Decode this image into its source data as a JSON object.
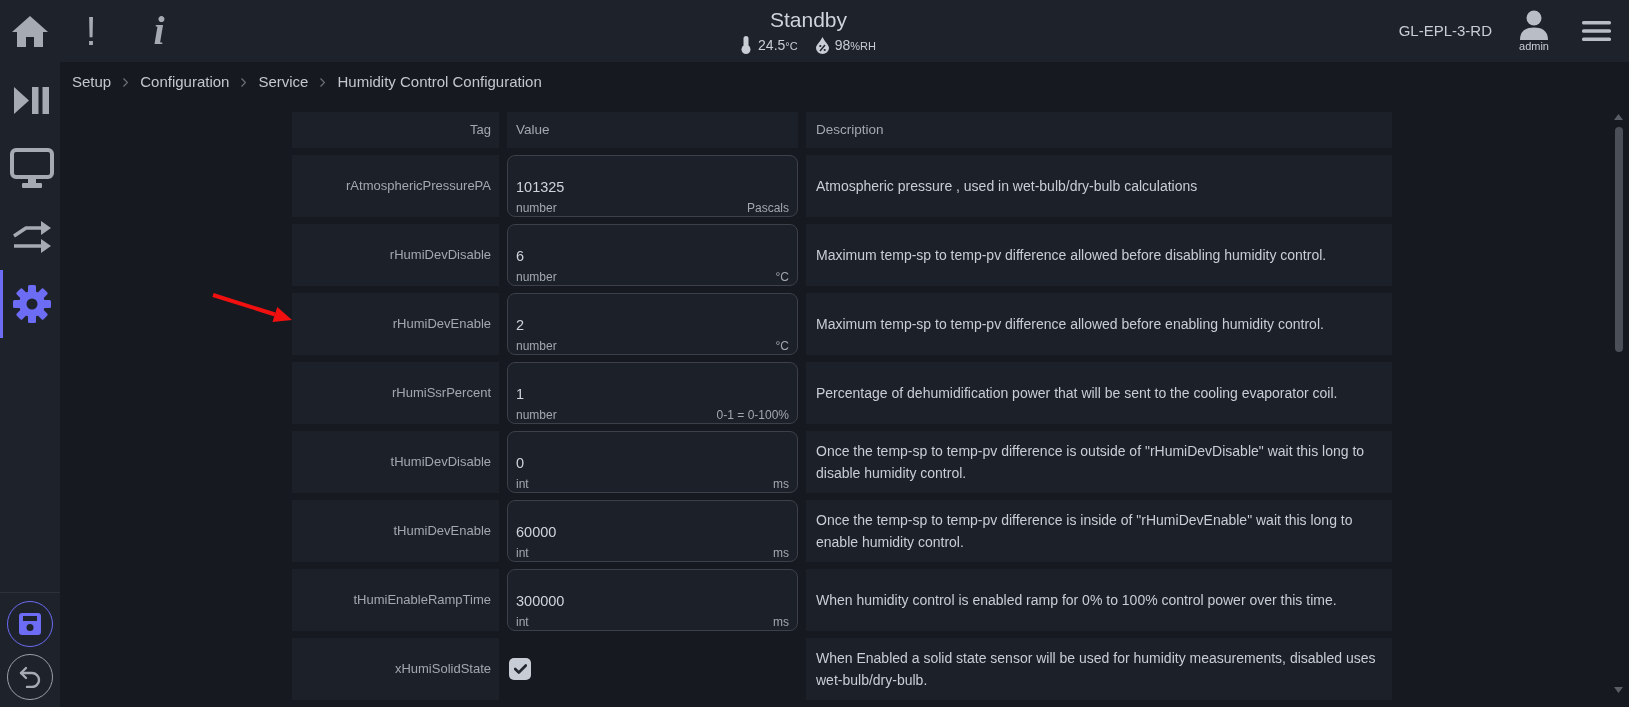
{
  "top_bar": {
    "buttons": [
      {
        "kind": "home"
      },
      {
        "kind": "alerts",
        "label": "!"
      },
      {
        "kind": "info",
        "label": "i"
      }
    ],
    "status": "Standby",
    "temperature": {
      "value": "24.5",
      "unit": "°C"
    },
    "humidity": {
      "value": "98",
      "unit": "%RH"
    },
    "device": "GL-EPL-3-RD",
    "user": "admin"
  },
  "sidebar": {
    "items": [
      {
        "kind": "play-pause",
        "selected": false
      },
      {
        "kind": "monitor",
        "selected": false
      },
      {
        "kind": "transfer",
        "selected": false
      },
      {
        "kind": "settings",
        "selected": true
      }
    ],
    "actions": [
      {
        "kind": "save",
        "highlighted": true
      },
      {
        "kind": "undo",
        "highlighted": false
      }
    ]
  },
  "breadcrumb": [
    "Setup",
    "Configuration",
    "Service",
    "Humidity Control Configuration"
  ],
  "table": {
    "columns": [
      "Tag",
      "Value",
      "Description"
    ],
    "rows": [
      {
        "tag": "rAtmosphericPressurePA",
        "kind": "field",
        "value": "101325",
        "data_type": "number",
        "unit": "Pascals",
        "description": "Atmospheric pressure , used in wet-bulb/dry-bulb calculations"
      },
      {
        "tag": "rHumiDevDisable",
        "kind": "field",
        "value": "6",
        "data_type": "number",
        "unit": "°C",
        "description": "Maximum temp-sp to temp-pv difference allowed before disabling humidity control."
      },
      {
        "tag": "rHumiDevEnable",
        "kind": "field",
        "value": "2",
        "data_type": "number",
        "unit": "°C",
        "description": "Maximum temp-sp to temp-pv difference allowed before enabling humidity control."
      },
      {
        "tag": "rHumiSsrPercent",
        "kind": "field",
        "value": "1",
        "data_type": "number",
        "unit": "0-1 = 0-100%",
        "description": "Percentage of dehumidification power that will be sent to the cooling evaporator coil."
      },
      {
        "tag": "tHumiDevDisable",
        "kind": "field",
        "value": "0",
        "data_type": "int",
        "unit": "ms",
        "description": "Once the temp-sp to temp-pv difference is outside of \"rHumiDevDisable\" wait this long to disable humidity control."
      },
      {
        "tag": "tHumiDevEnable",
        "kind": "field",
        "value": "60000",
        "data_type": "int",
        "unit": "ms",
        "description": "Once the temp-sp to temp-pv difference is inside of \"rHumiDevEnable\" wait this long to enable humidity control."
      },
      {
        "tag": "tHumiEnableRampTime",
        "kind": "field",
        "value": "300000",
        "data_type": "int",
        "unit": "ms",
        "description": "When humidity control is enabled ramp for 0% to 100% control power over this time."
      },
      {
        "tag": "xHumiSolidState",
        "kind": "checkbox",
        "checked": true,
        "description": "When Enabled a solid state sensor will be used for humidity measurements, disabled uses wet-bulb/dry-bulb."
      }
    ]
  }
}
